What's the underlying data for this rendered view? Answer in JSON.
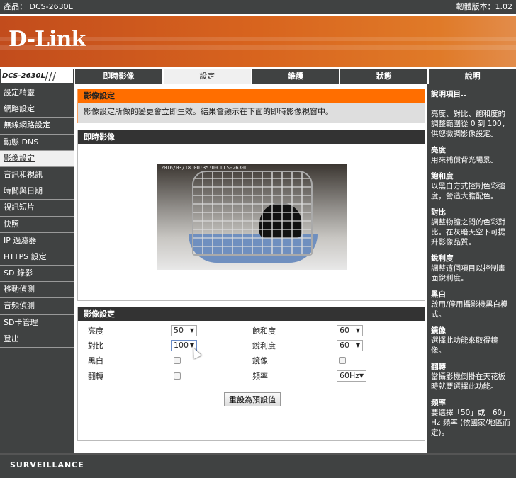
{
  "topbar": {
    "product": "產品： DCS-2630L",
    "firmware": "韌體版本：1.02"
  },
  "banner": {
    "logo": "D-Link"
  },
  "tabs": {
    "model": "DCS-2630L",
    "items": [
      "即時影像",
      "設定",
      "維護",
      "狀態",
      "說明"
    ],
    "active": 1
  },
  "sidebar": {
    "items": [
      "設定精靈",
      "網路設定",
      "無線網路設定",
      "動態 DNS",
      "影像設定",
      "音訊和視訊",
      "時間與日期",
      "視訊短片",
      "快照",
      "IP 過濾器",
      "HTTPS 設定",
      "SD 錄影",
      "移動偵測",
      "音頻偵測",
      "SD卡管理",
      "登出"
    ],
    "active": 4
  },
  "intro": {
    "title": "影像設定",
    "text": "影像設定所做的變更會立即生效。結果會顯示在下面的即時影像視窗中。"
  },
  "live": {
    "title": "即時影像",
    "timestamp": "2016/03/18 00:35:00 DCS-2630L"
  },
  "settings": {
    "title": "影像設定",
    "brightness": {
      "label": "亮度",
      "value": "50"
    },
    "saturation": {
      "label": "飽和度",
      "value": "60"
    },
    "contrast": {
      "label": "對比",
      "value": "100"
    },
    "sharpness": {
      "label": "銳利度",
      "value": "60"
    },
    "bw": {
      "label": "黑白",
      "checked": false
    },
    "mirror": {
      "label": "鏡像",
      "checked": false
    },
    "flip": {
      "label": "翻轉",
      "checked": false
    },
    "frequency": {
      "label": "頻率",
      "value": "60Hz"
    },
    "reset": "重設為預設值"
  },
  "help": {
    "title": "說明項目..",
    "intro": "亮度、對比、飽和度的調整範圍從 0 到 100，供您微調影像設定。",
    "items": [
      {
        "t": "亮度",
        "d": "用來補償背光場景。"
      },
      {
        "t": "飽和度",
        "d": "以黑白方式控制色彩強度，營造大膽配色。"
      },
      {
        "t": "對比",
        "d": "調整物體之間的色彩對比。在灰暗天空下可提升影像品質。"
      },
      {
        "t": "銳利度",
        "d": "調整這個項目以控制畫面銳利度。"
      },
      {
        "t": "黑白",
        "d": "啟用/停用攝影機黑白模式。"
      },
      {
        "t": "鏡像",
        "d": "選擇此功能來取得鏡像。"
      },
      {
        "t": "翻轉",
        "d": "當攝影機倒掛在天花板時就要選擇此功能。"
      },
      {
        "t": "頻率",
        "d": "要選擇「50」或「60」Hz 頻率 (依國家/地區而定)。"
      }
    ]
  },
  "footer": {
    "text": "SURVEILLANCE"
  }
}
